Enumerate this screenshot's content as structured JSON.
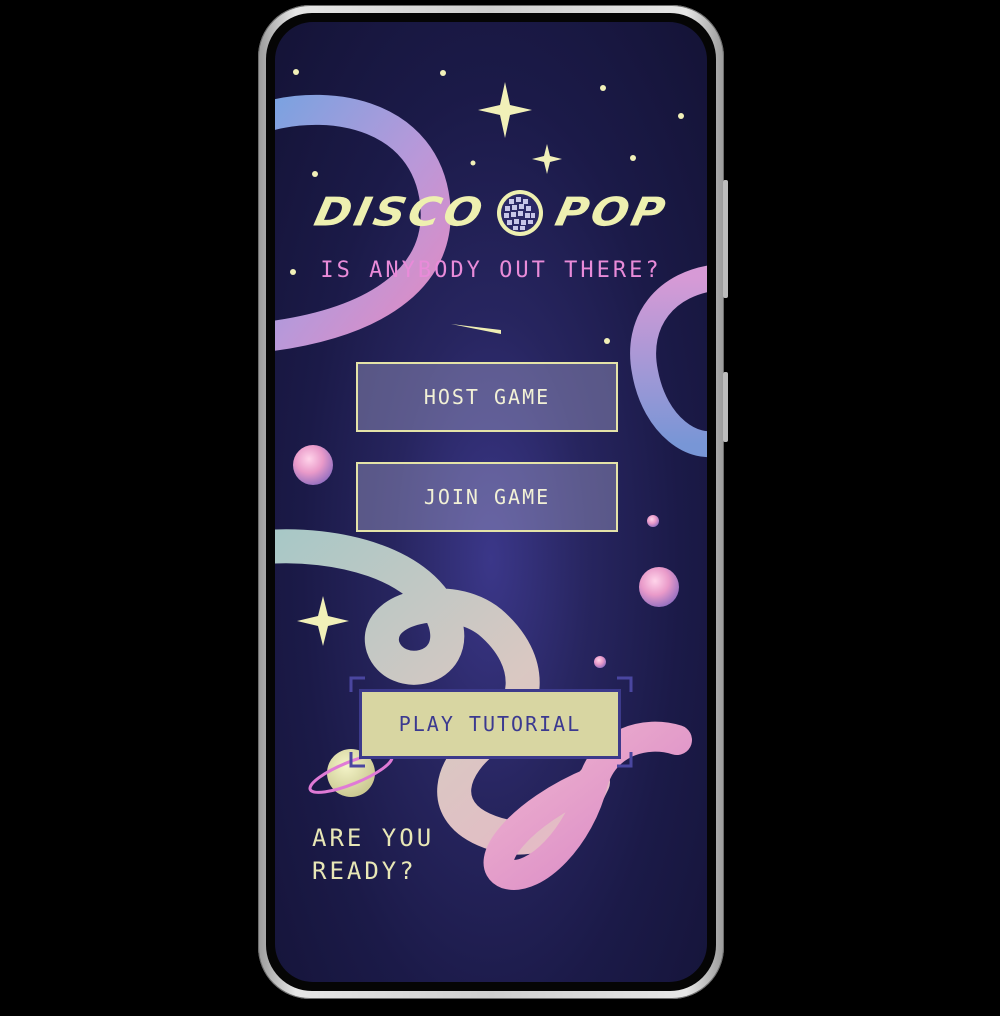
{
  "app": {
    "logo_left": "DISCO",
    "logo_right": "POP",
    "tagline": "IS ANYBODY OUT THERE?"
  },
  "menu": {
    "host_label": "HOST GAME",
    "join_label": "JOIN GAME",
    "tutorial_label": "PLAY TUTORIAL"
  },
  "footer": {
    "ready_line1": "ARE YOU",
    "ready_line2": "READY?"
  },
  "icons": {
    "logo_mark": "disco-ball-icon",
    "decor": [
      "sparkle-icon",
      "planet-icon",
      "bubble-icon",
      "tube-icon"
    ]
  },
  "colors": {
    "background": "#1b1a48",
    "accent_yellow": "#eef0b0",
    "accent_pink": "#e98bd9",
    "button_outline": "#e4e3a8",
    "tutorial_fill": "#d8d6a2",
    "tutorial_text": "#3b3990"
  }
}
